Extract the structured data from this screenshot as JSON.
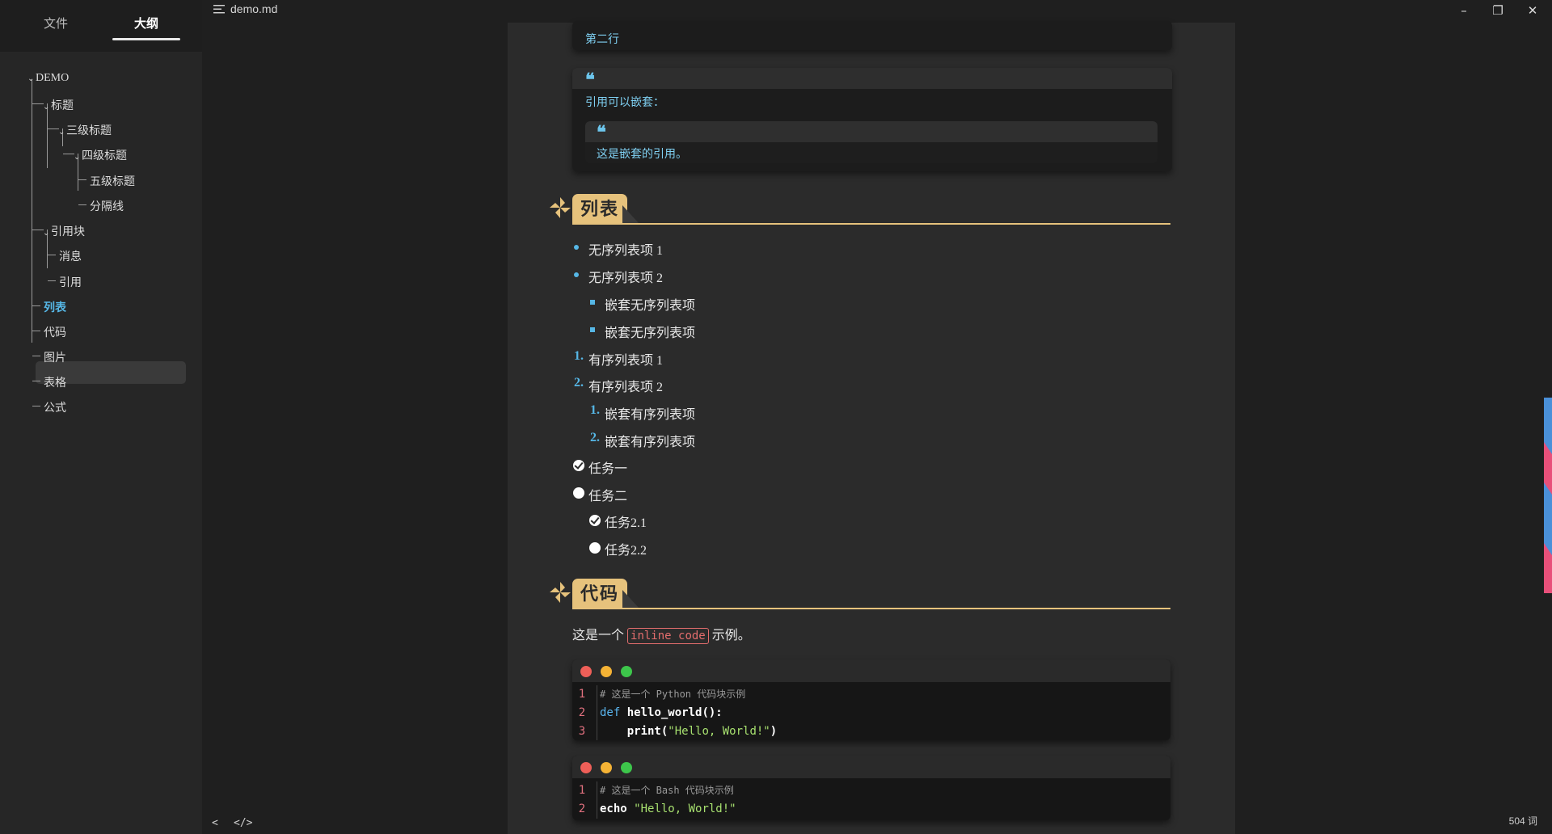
{
  "sidebar": {
    "tabs": [
      "文件",
      "大纲"
    ],
    "active_tab": "大纲",
    "outline": [
      {
        "label": "DEMO",
        "level": 0,
        "expanded": true
      },
      {
        "label": "标题",
        "level": 1,
        "expanded": true
      },
      {
        "label": "三级标题",
        "level": 2,
        "expanded": true
      },
      {
        "label": "四级标题",
        "level": 3,
        "expanded": true
      },
      {
        "label": "五级标题",
        "level": 4
      },
      {
        "label": "分隔线",
        "level": 4
      },
      {
        "label": "引用块",
        "level": 1,
        "expanded": true
      },
      {
        "label": "消息",
        "level": 2
      },
      {
        "label": "引用",
        "level": 2
      },
      {
        "label": "列表",
        "level": 1,
        "active": true
      },
      {
        "label": "代码",
        "level": 1
      },
      {
        "label": "图片",
        "level": 1
      },
      {
        "label": "表格",
        "level": 1
      },
      {
        "label": "公式",
        "level": 1
      }
    ]
  },
  "titlebar": {
    "doc_title": "demo.md",
    "menu_icon": "hamburger-icon",
    "window_buttons": [
      "minimize-icon",
      "restore-icon",
      "close-icon"
    ]
  },
  "content": {
    "quote1_line": "第二行",
    "quote2_line": "引用可以嵌套：",
    "nested_quote_line": "这是嵌套的引用。",
    "heading_lists": "列表",
    "lists": {
      "unordered": [
        "无序列表项 1",
        "无序列表项 2"
      ],
      "unordered_nested": [
        "嵌套无序列表项",
        "嵌套无序列表项"
      ],
      "ordered": [
        {
          "num": "1.",
          "text": "有序列表项 1"
        },
        {
          "num": "2.",
          "text": "有序列表项 2"
        }
      ],
      "ordered_nested": [
        {
          "num": "1.",
          "text": "嵌套有序列表项"
        },
        {
          "num": "2.",
          "text": "嵌套有序列表项"
        }
      ],
      "tasks": [
        {
          "text": "任务一",
          "done": true
        },
        {
          "text": "任务二",
          "done": false
        }
      ],
      "tasks_nested": [
        {
          "text": "任务2.1",
          "done": true
        },
        {
          "text": "任务2.2",
          "done": false
        }
      ]
    },
    "heading_code": "代码",
    "inline_para_before": "这是一个",
    "inline_code": "inline code",
    "inline_para_after": "示例。",
    "code_blocks": [
      {
        "lang": "python",
        "lines": [
          {
            "n": "1",
            "comment": "# 这是一个 Python 代码块示例"
          },
          {
            "n": "2",
            "kw": "def",
            "fn": "hello_world():"
          },
          {
            "n": "3",
            "indent": "    ",
            "fn": "print(",
            "str": "\"Hello, World!\"",
            "tail": ")"
          }
        ]
      },
      {
        "lang": "bash",
        "lines": [
          {
            "n": "1",
            "comment": "# 这是一个 Bash 代码块示例"
          },
          {
            "n": "2",
            "fn": "echo",
            "str": "\"Hello, World!\""
          }
        ]
      }
    ]
  },
  "status": {
    "word_count": "504 词"
  },
  "colors": {
    "accent_blue": "#56b7e6",
    "heading_gold": "#e6c27c",
    "inline_code_red": "#e36d6d"
  }
}
